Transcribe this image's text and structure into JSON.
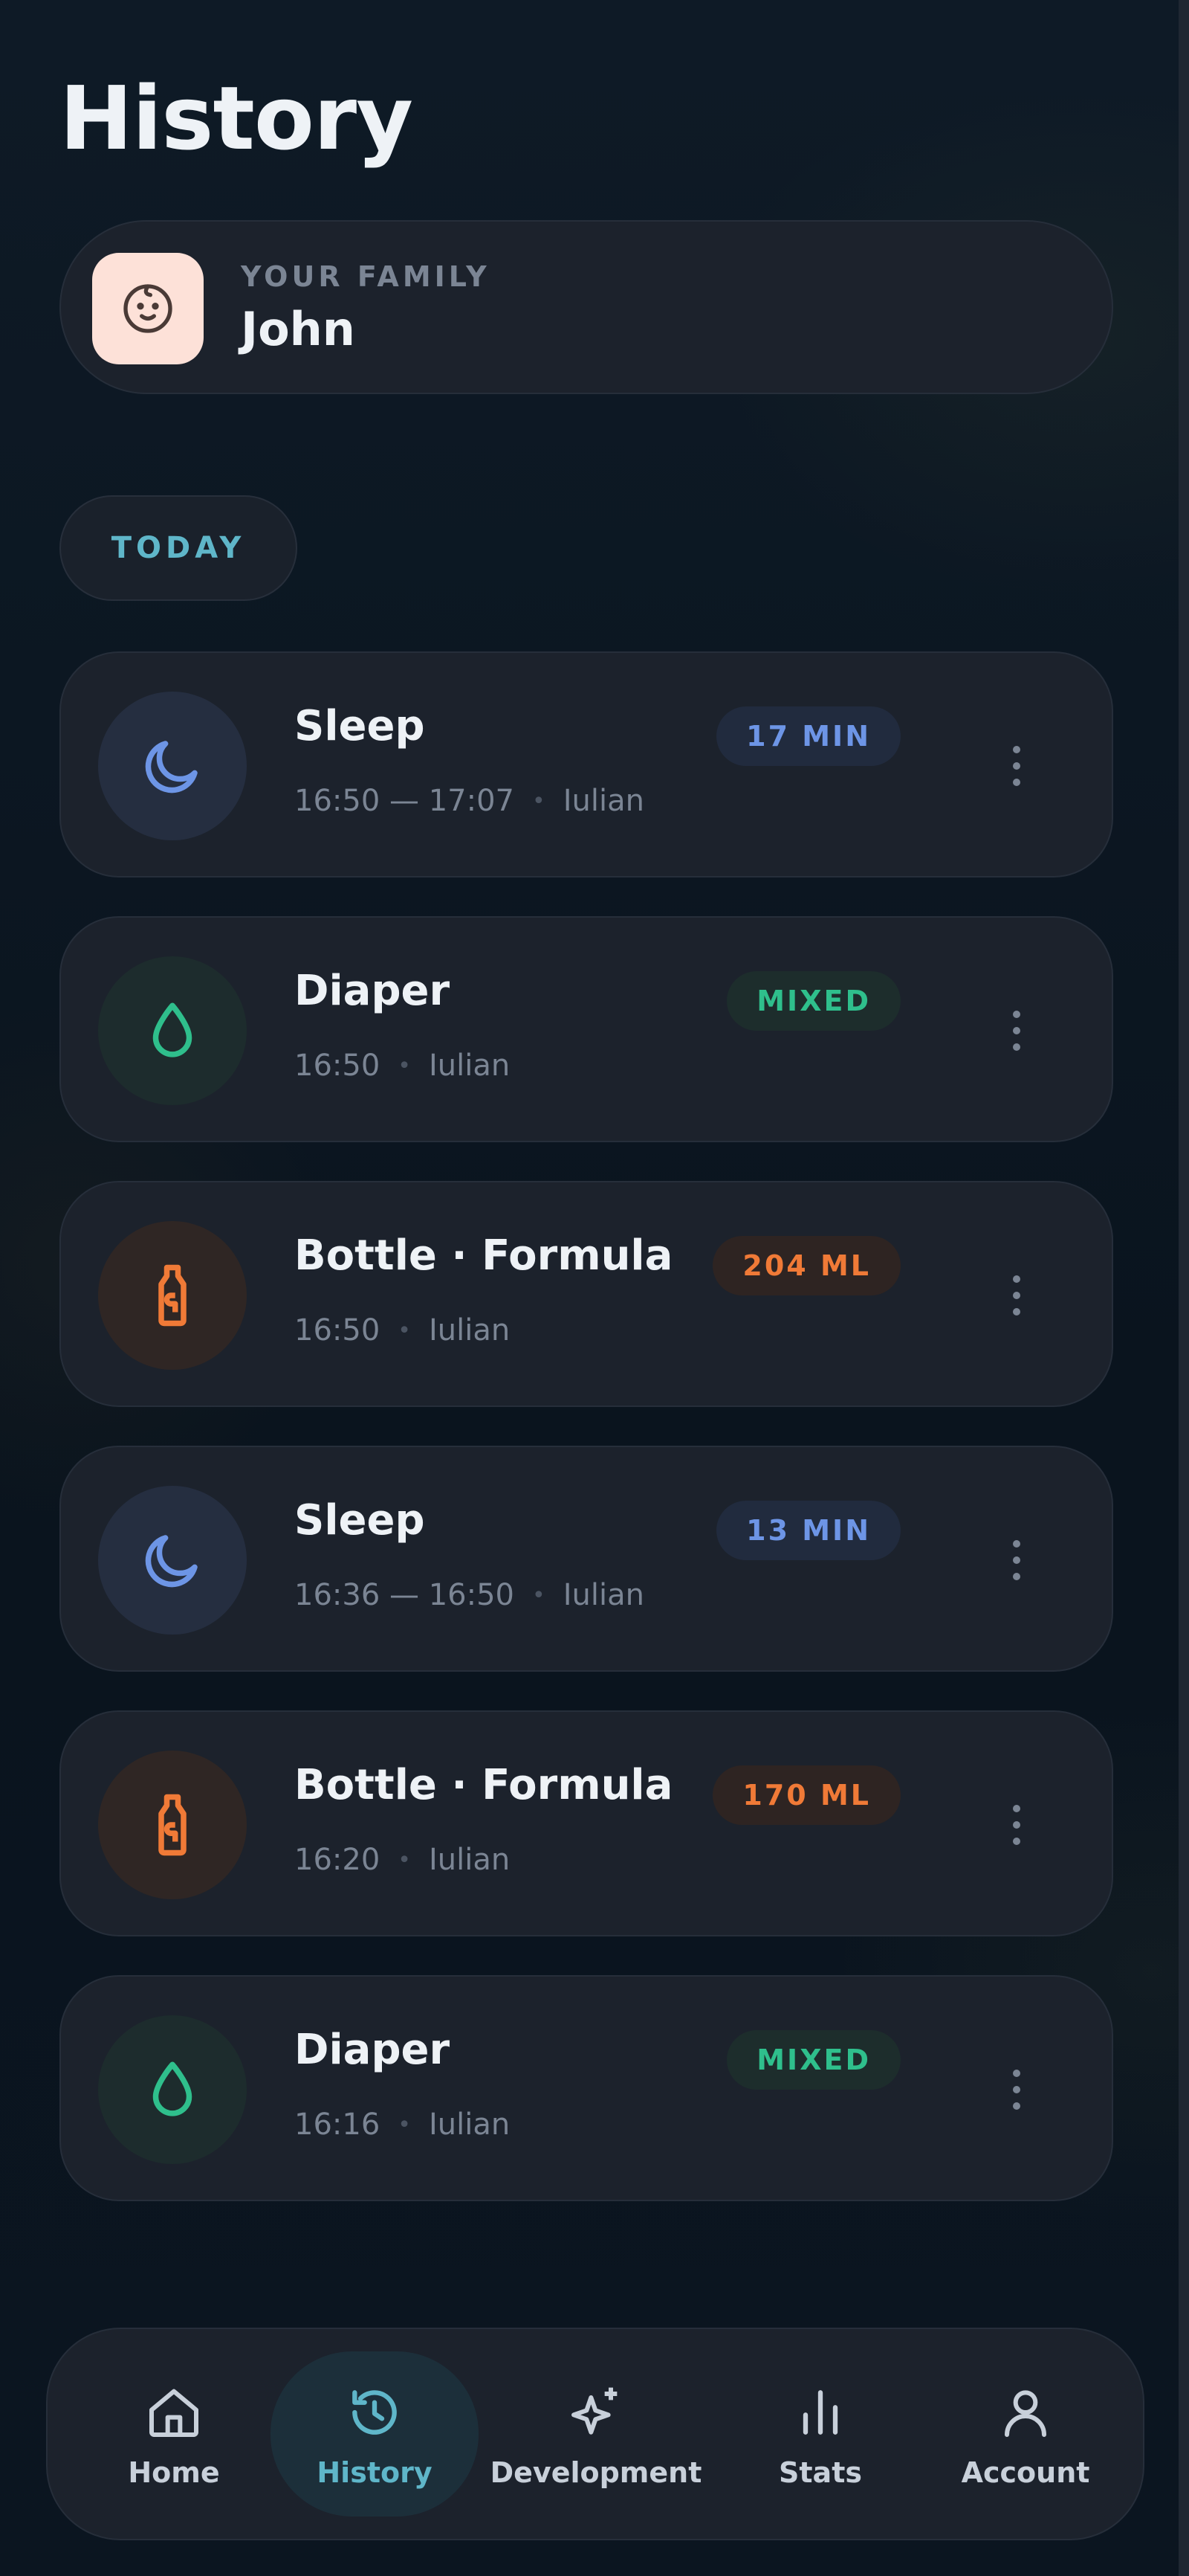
{
  "header": {
    "title": "History"
  },
  "family": {
    "label": "YOUR FAMILY",
    "name": "John",
    "avatar_icon": "baby-face-icon"
  },
  "section": {
    "today_label": "TODAY"
  },
  "entries": [
    {
      "type": "sleep",
      "title": "Sleep",
      "time": "16:50 — 17:07",
      "by": "Iulian",
      "badge": "17 MIN",
      "icon": "moon-icon"
    },
    {
      "type": "diaper",
      "title": "Diaper",
      "time": "16:50",
      "by": "Iulian",
      "badge": "MIXED",
      "icon": "drop-icon"
    },
    {
      "type": "bottle",
      "title": "Bottle · Formula",
      "time": "16:50",
      "by": "Iulian",
      "badge": "204 ML",
      "icon": "bottle-icon"
    },
    {
      "type": "sleep",
      "title": "Sleep",
      "time": "16:36 — 16:50",
      "by": "Iulian",
      "badge": "13 MIN",
      "icon": "moon-icon"
    },
    {
      "type": "bottle",
      "title": "Bottle · Formula",
      "time": "16:20",
      "by": "Iulian",
      "badge": "170 ML",
      "icon": "bottle-icon"
    },
    {
      "type": "diaper",
      "title": "Diaper",
      "time": "16:16",
      "by": "Iulian",
      "badge": "MIXED",
      "icon": "drop-icon"
    }
  ],
  "nav": {
    "items": [
      {
        "label": "Home",
        "icon": "home-icon"
      },
      {
        "label": "History",
        "icon": "history-icon",
        "active": true
      },
      {
        "label": "Development",
        "icon": "sparkle-icon"
      },
      {
        "label": "Stats",
        "icon": "bar-chart-icon"
      },
      {
        "label": "Account",
        "icon": "user-icon"
      }
    ]
  },
  "colors": {
    "accent": "#5fb6c9",
    "sleep": "#6d95e6",
    "diaper": "#2fbf8c",
    "bottle": "#f07a37",
    "card": "#1c222c"
  }
}
